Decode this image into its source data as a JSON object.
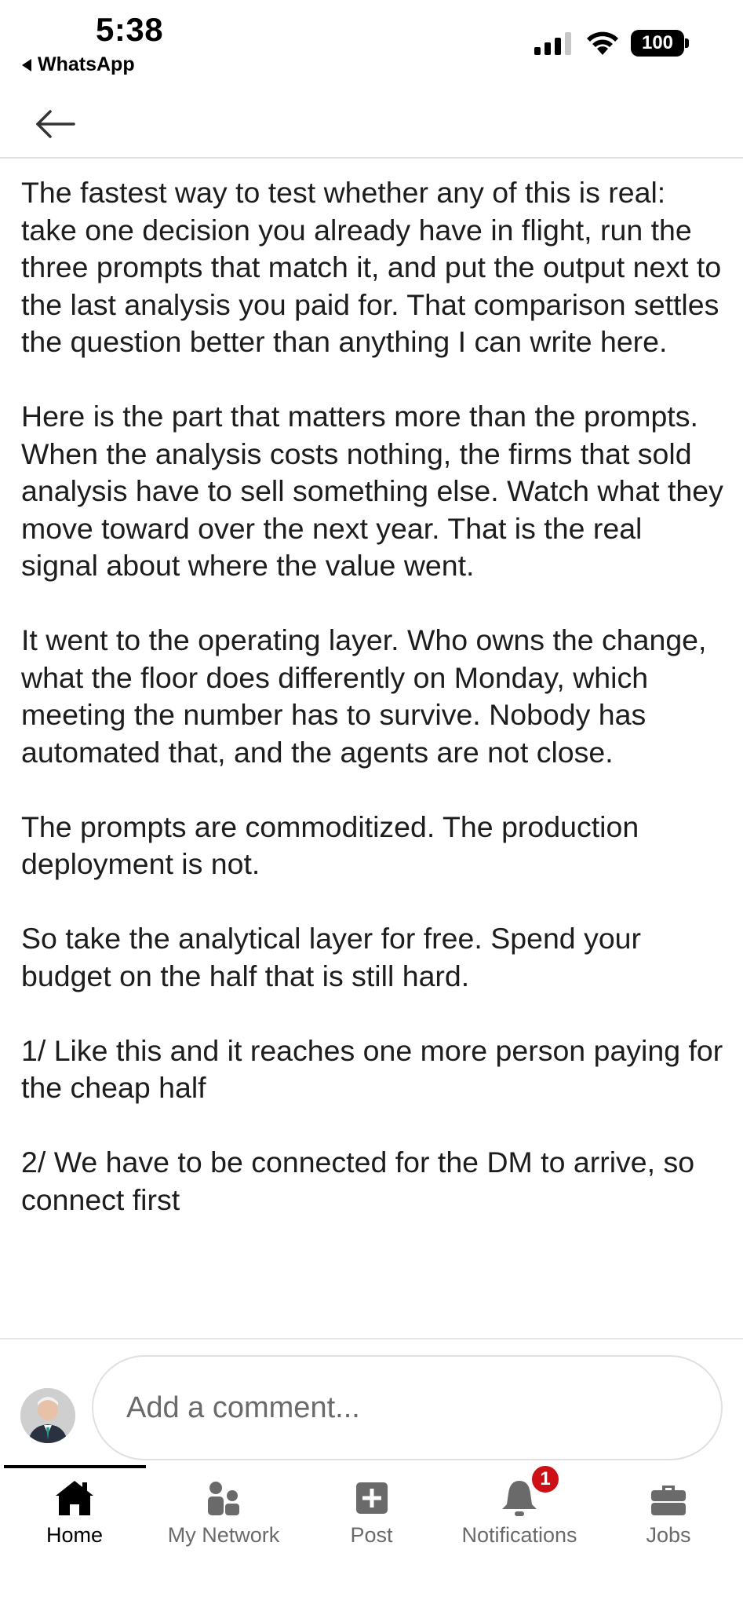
{
  "status_bar": {
    "time": "5:38",
    "back_app_label": "WhatsApp",
    "battery_level": "100",
    "signal_bars": 3
  },
  "header": {
    "back_icon": "back-arrow-icon"
  },
  "post": {
    "paragraphs": [
      "The fastest way to test whether any of this is real: take one decision you already have in flight, run the three prompts that match it, and put the output next to the last analysis you paid for. That comparison settles the question better than anything I can write here.",
      "Here is the part that matters more than the prompts. When the analysis costs nothing, the firms that sold analysis have to sell something else. Watch what they move toward over the next year. That is the real signal about where the value went.",
      "It went to the operating layer. Who owns the change, what the floor does differently on Monday, which meeting the number has to survive. Nobody has automated that, and the agents are not close.",
      "The prompts are commoditized. The production deployment is not.",
      "So take the analytical layer for free. Spend your budget on the half that is still hard.",
      "1/ Like this and it reaches one more person paying for the cheap half",
      "2/ We have to be connected for the DM to arrive, so connect first"
    ]
  },
  "comment": {
    "placeholder": "Add a comment..."
  },
  "tabs": [
    {
      "label": "Home",
      "icon": "home-icon",
      "active": true
    },
    {
      "label": "My Network",
      "icon": "network-icon",
      "active": false
    },
    {
      "label": "Post",
      "icon": "post-icon",
      "active": false
    },
    {
      "label": "Notifications",
      "icon": "bell-icon",
      "active": false,
      "badge": "1"
    },
    {
      "label": "Jobs",
      "icon": "briefcase-icon",
      "active": false
    }
  ],
  "colors": {
    "badge": "#cc1016",
    "active_tab": "#000000",
    "inactive_tab": "#6a6a6a",
    "text": "#1d1d1d"
  }
}
